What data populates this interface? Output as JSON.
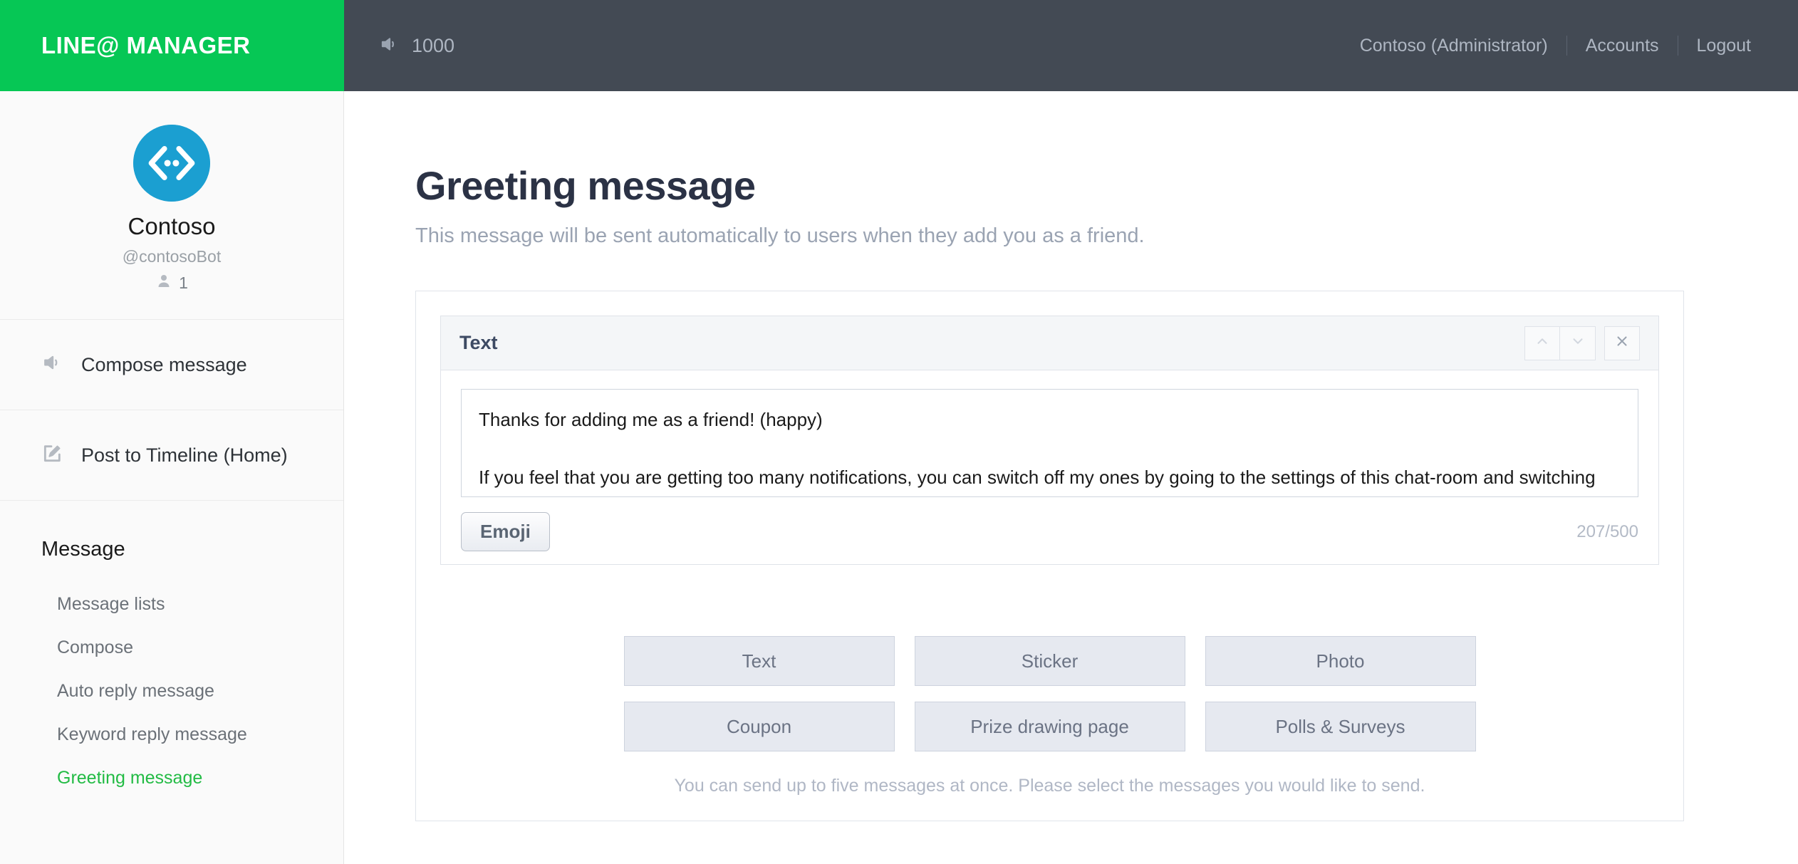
{
  "brand": {
    "name": "LINE@ MANAGER"
  },
  "topnav": {
    "broadcast_icon": "speaker-icon",
    "broadcast_count": "1000",
    "account_label": "Contoso (Administrator)",
    "accounts_label": "Accounts",
    "logout_label": "Logout"
  },
  "sidebar": {
    "profile": {
      "avatar_icon": "bot-framework-logo",
      "name": "Contoso",
      "handle": "@contosoBot",
      "friends_icon": "person-icon",
      "friends_count": "1"
    },
    "main_items": [
      {
        "icon": "speaker-icon",
        "label": "Compose message"
      },
      {
        "icon": "edit-square-icon",
        "label": "Post to Timeline (Home)"
      }
    ],
    "section": {
      "title": "Message",
      "items": [
        {
          "label": "Message lists",
          "active": false
        },
        {
          "label": "Compose",
          "active": false
        },
        {
          "label": "Auto reply message",
          "active": false
        },
        {
          "label": "Keyword reply message",
          "active": false
        },
        {
          "label": "Greeting message",
          "active": true
        }
      ]
    }
  },
  "main": {
    "title": "Greeting message",
    "subtitle": "This message will be sent automatically to users when they add you as a friend.",
    "message_card": {
      "title": "Text",
      "controls": [
        {
          "name": "move-up-button",
          "icon": "chevron-up-icon"
        },
        {
          "name": "move-down-button",
          "icon": "chevron-down-icon"
        },
        {
          "name": "remove-button",
          "icon": "close-icon"
        }
      ],
      "text_value": "Thanks for adding me as a friend! (happy)\n\nIf you feel that you are getting too many notifications, you can switch off my ones by going to the settings of this chat-room and switching Notifications OFF. (ok)",
      "text_placeholder": "",
      "emoji_label": "Emoji",
      "char_count": "207/500"
    },
    "type_buttons": [
      "Text",
      "Sticker",
      "Photo",
      "Coupon",
      "Prize drawing page",
      "Polls & Surveys"
    ],
    "hint": "You can send up to five messages at once. Please select the messages you would like to send."
  },
  "colors": {
    "brand_green": "#06c755",
    "active_green": "#22bb44",
    "topbar_dark": "#434a54",
    "avatar_blue": "#1b9fd1"
  }
}
